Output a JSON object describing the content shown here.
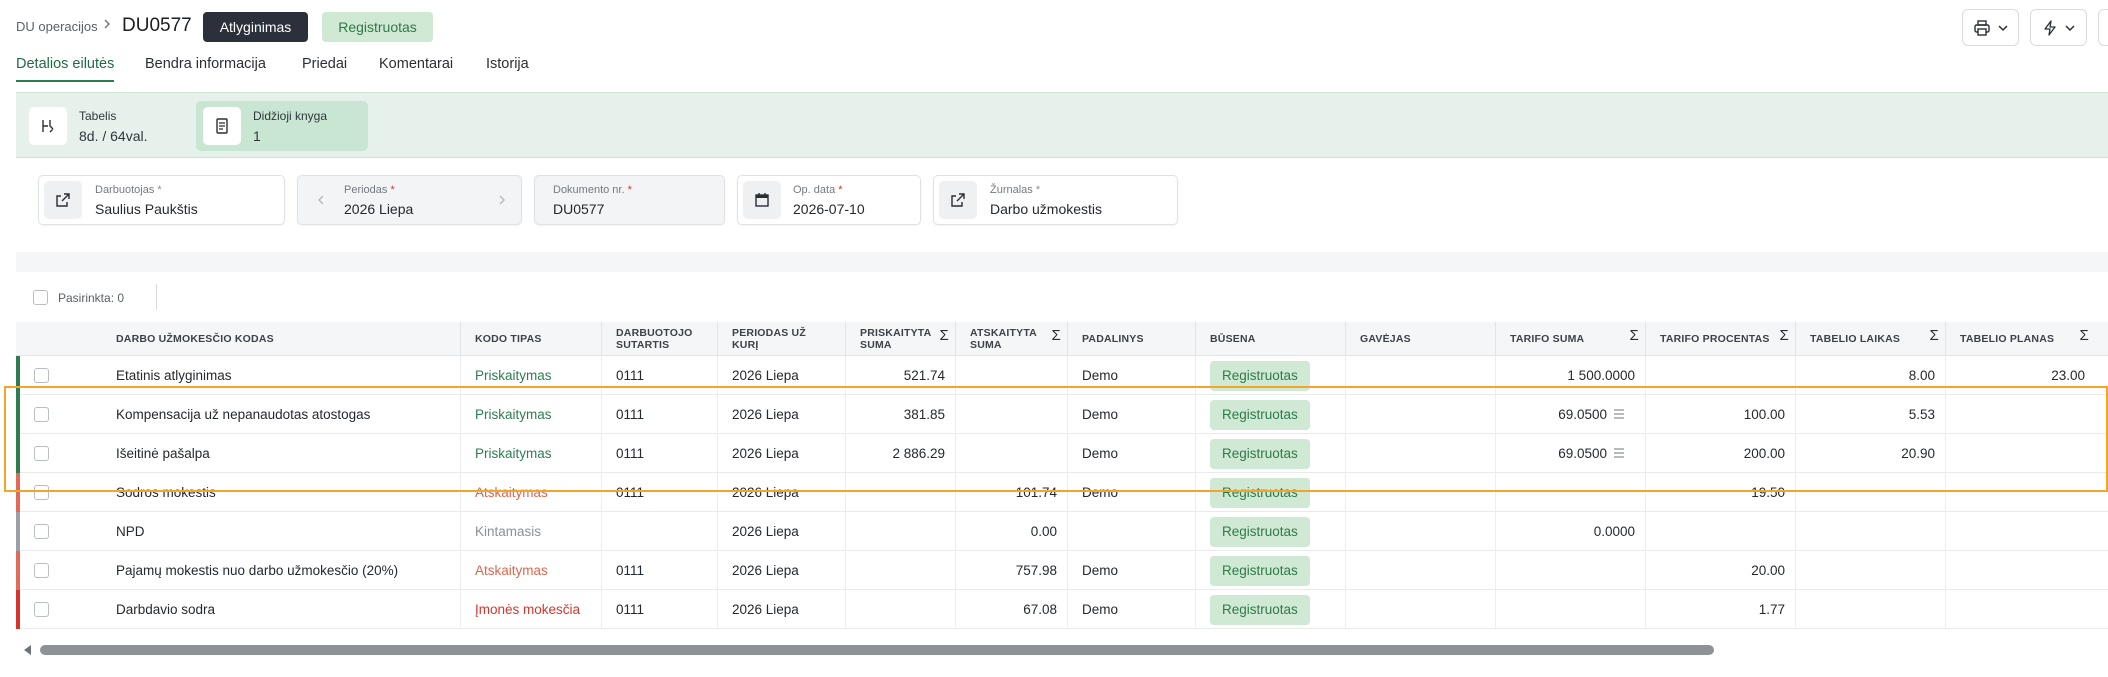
{
  "header": {
    "breadcrumb": "DU operacijos",
    "doc_id": "DU0577",
    "type_button": "Atlyginimas",
    "status_badge": "Registruotas",
    "toolbar_icons": [
      "printer-icon",
      "bolt-icon"
    ]
  },
  "tabs": [
    {
      "label": "Detalios eilutės",
      "active": true
    },
    {
      "label": "Bendra informacija",
      "active": false
    },
    {
      "label": "Priedai",
      "active": false
    },
    {
      "label": "Komentarai",
      "active": false
    },
    {
      "label": "Istorija",
      "active": false
    }
  ],
  "summary": {
    "tabelis": {
      "label": "Tabelis",
      "value": "8d. / 64val."
    },
    "book": {
      "label": "Didžioji knyga",
      "value": "1"
    }
  },
  "form": {
    "employee": {
      "label": "Darbuotojas",
      "req": "*",
      "value": "Saulius Paukštis"
    },
    "period": {
      "label": "Periodas",
      "req": "*",
      "value": "2026 Liepa"
    },
    "doc_no": {
      "label": "Dokumento nr.",
      "req": "*",
      "value": "DU0577"
    },
    "op_date": {
      "label": "Op. data",
      "req": "*",
      "value": "2026-07-10"
    },
    "journal": {
      "label": "Žurnalas",
      "req": "*",
      "value": "Darbo užmokestis"
    }
  },
  "selection": {
    "text": "Pasirinkta: 0"
  },
  "table": {
    "columns": [
      {
        "key": "code",
        "label": "DARBO UŽMOKESČIO KODAS",
        "sigma": ""
      },
      {
        "key": "type",
        "label": "KODO TIPAS",
        "sigma": ""
      },
      {
        "key": "contract",
        "label": "DARBUOTOJO SUTARTIS",
        "sigma": ""
      },
      {
        "key": "period",
        "label": "PERIODAS UŽ KURĮ",
        "sigma": ""
      },
      {
        "key": "accrued",
        "label": "PRISKAITYTA SUMA",
        "sigma": "Σ"
      },
      {
        "key": "deducted",
        "label": "ATSKAITYTA SUMA",
        "sigma": "Σ"
      },
      {
        "key": "dept",
        "label": "PADALINYS",
        "sigma": ""
      },
      {
        "key": "status",
        "label": "BŪSENA",
        "sigma": ""
      },
      {
        "key": "recipient",
        "label": "GAVĖJAS",
        "sigma": ""
      },
      {
        "key": "rate_sum",
        "label": "TARIFO SUMA",
        "sigma": "Σ"
      },
      {
        "key": "rate_pct",
        "label": "TARIFO PROCENTAS",
        "sigma": "Σ"
      },
      {
        "key": "time",
        "label": "TABELIO LAIKAS",
        "sigma": "Σ"
      },
      {
        "key": "plan",
        "label": "TABELIO PLANAS",
        "sigma": "Σ"
      }
    ],
    "rows": [
      {
        "code": "Etatinis atlyginimas",
        "type": "Priskaitymas",
        "type_kind": "accrual",
        "contract": "0111",
        "period": "2026 Liepa",
        "accrued": "521.74",
        "deducted": "",
        "dept": "Demo",
        "status": "Registruotas",
        "recipient": "",
        "rate_sum": "1 500.0000",
        "rate_sum_lines": false,
        "rate_pct": "",
        "time": "8.00",
        "plan": "23.00"
      },
      {
        "code": "Kompensacija už nepanaudotas atostogas",
        "type": "Priskaitymas",
        "type_kind": "accrual",
        "contract": "0111",
        "period": "2026 Liepa",
        "accrued": "381.85",
        "deducted": "",
        "dept": "Demo",
        "status": "Registruotas",
        "recipient": "",
        "rate_sum": "69.0500",
        "rate_sum_lines": true,
        "rate_pct": "100.00",
        "time": "5.53",
        "plan": ""
      },
      {
        "code": "Išeitinė pašalpa",
        "type": "Priskaitymas",
        "type_kind": "accrual",
        "contract": "0111",
        "period": "2026 Liepa",
        "accrued": "2 886.29",
        "deducted": "",
        "dept": "Demo",
        "status": "Registruotas",
        "recipient": "",
        "rate_sum": "69.0500",
        "rate_sum_lines": true,
        "rate_pct": "200.00",
        "time": "20.90",
        "plan": ""
      },
      {
        "code": "Sodros mokestis",
        "type": "Atskaitymas",
        "type_kind": "deduction",
        "contract": "0111",
        "period": "2026 Liepa",
        "accrued": "",
        "deducted": "101.74",
        "dept": "Demo",
        "status": "Registruotas",
        "recipient": "",
        "rate_sum": "",
        "rate_sum_lines": false,
        "rate_pct": "19.50",
        "time": "",
        "plan": ""
      },
      {
        "code": "NPD",
        "type": "Kintamasis",
        "type_kind": "variable",
        "contract": "",
        "period": "2026 Liepa",
        "accrued": "",
        "deducted": "0.00",
        "dept": "",
        "status": "Registruotas",
        "recipient": "",
        "rate_sum": "0.0000",
        "rate_sum_lines": false,
        "rate_pct": "",
        "time": "",
        "plan": ""
      },
      {
        "code": "Pajamų mokestis nuo darbo užmokesčio (20%)",
        "type": "Atskaitymas",
        "type_kind": "deduction",
        "contract": "0111",
        "period": "2026 Liepa",
        "accrued": "",
        "deducted": "757.98",
        "dept": "Demo",
        "status": "Registruotas",
        "recipient": "",
        "rate_sum": "",
        "rate_sum_lines": false,
        "rate_pct": "20.00",
        "time": "",
        "plan": ""
      },
      {
        "code": "Darbdavio sodra",
        "type": "Įmonės mokesčia",
        "type_kind": "employer",
        "contract": "0111",
        "period": "2026 Liepa",
        "accrued": "",
        "deducted": "67.08",
        "dept": "Demo",
        "status": "Registruotas",
        "recipient": "",
        "rate_sum": "",
        "rate_sum_lines": false,
        "rate_pct": "1.77",
        "time": "",
        "plan": ""
      }
    ]
  },
  "colors": {
    "accrual": "#2e7d52",
    "deduction": "#e0654f",
    "variable": "#8c9197",
    "employer": "#d9342b",
    "bar_accrual": "#2e7d52",
    "bar_deduction": "#e06b5a",
    "bar_variable": "#9aa0a6",
    "bar_employer": "#d9342b"
  }
}
